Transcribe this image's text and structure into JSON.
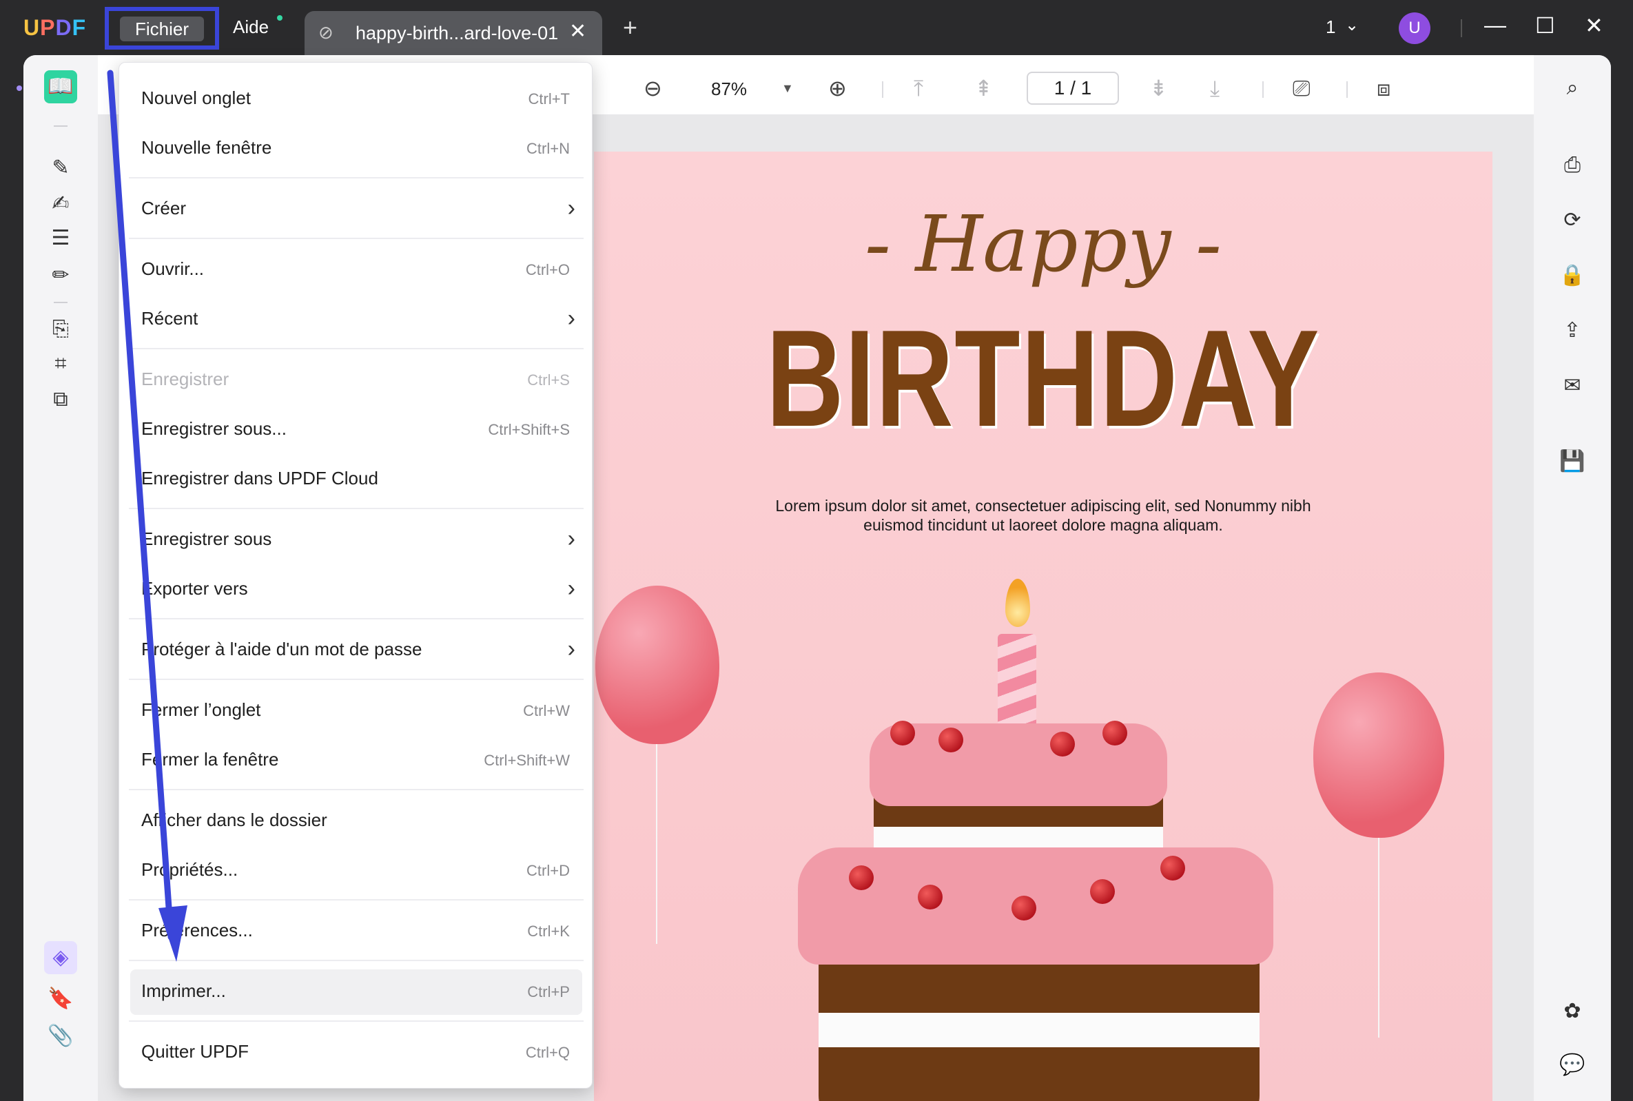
{
  "app": {
    "logo": "UPDF",
    "menus": {
      "file": "Fichier",
      "help": "Aide"
    },
    "tab": {
      "title": "happy-birth...ard-love-01"
    },
    "page_indicator": "1",
    "avatar_initial": "U"
  },
  "toolbar": {
    "zoom": "87%",
    "page": "1 / 1"
  },
  "document": {
    "happy": "- Happy -",
    "birthday": "BIRTHDAY",
    "lorem": "Lorem ipsum dolor sit amet, consectetuer adipiscing elit, sed Nonummy nibh euismod tincidunt ut laoreet dolore magna aliquam."
  },
  "file_menu": {
    "items": [
      {
        "label": "Nouvel onglet",
        "shortcut": "Ctrl+T"
      },
      {
        "label": "Nouvelle fenêtre",
        "shortcut": "Ctrl+N"
      },
      {
        "label": "Créer",
        "shortcut": ""
      },
      {
        "label": "Ouvrir...",
        "shortcut": "Ctrl+O"
      },
      {
        "label": "Récent",
        "shortcut": ""
      },
      {
        "label": "Enregistrer",
        "shortcut": "Ctrl+S"
      },
      {
        "label": "Enregistrer sous...",
        "shortcut": "Ctrl+Shift+S"
      },
      {
        "label": "Enregistrer dans UPDF Cloud",
        "shortcut": ""
      },
      {
        "label": "Enregistrer sous",
        "shortcut": ""
      },
      {
        "label": "Exporter vers",
        "shortcut": ""
      },
      {
        "label": "Protéger à l'aide d'un mot de passe",
        "shortcut": ""
      },
      {
        "label": "Fermer l’onglet",
        "shortcut": "Ctrl+W"
      },
      {
        "label": "Fermer la fenêtre",
        "shortcut": "Ctrl+Shift+W"
      },
      {
        "label": "Afficher dans le dossier",
        "shortcut": ""
      },
      {
        "label": "Propriétés...",
        "shortcut": "Ctrl+D"
      },
      {
        "label": "Préférences...",
        "shortcut": "Ctrl+K"
      },
      {
        "label": "Imprimer...",
        "shortcut": "Ctrl+P"
      },
      {
        "label": "Quitter UPDF",
        "shortcut": "Ctrl+Q"
      }
    ]
  },
  "colors": {
    "accent_green": "#2fd4a0",
    "annotation_blue": "#3a45d9",
    "avatar_purple": "#8e4de0",
    "card_pink": "#fcd2d6",
    "birthday_brown": "#7a4213"
  }
}
